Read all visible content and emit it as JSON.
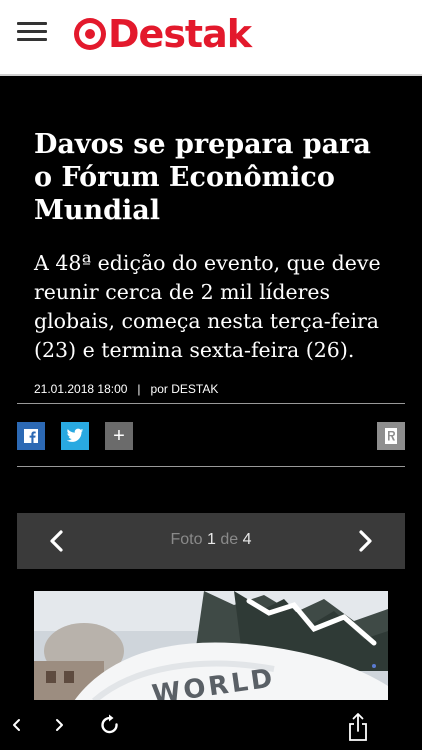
{
  "header": {
    "logo_text": "Destak",
    "brand_color": "#e3192c"
  },
  "article": {
    "title": "Davos se prepara para o Fórum Econômico Mundial",
    "lede": "A 48ª edição do evento, que deve reunir cerca de 2 mil líderes globais, começa nesta terça-feira (23) e termina sexta-feira (26).",
    "date": "21.01.2018 18:00",
    "separator": "|",
    "byline": "por DESTAK"
  },
  "share": {
    "icons": [
      "facebook-icon",
      "twitter-icon",
      "plus-icon",
      "r-icon"
    ],
    "plus_label": "+"
  },
  "gallery": {
    "foto_label": "Foto",
    "current": "1",
    "of_label": "de",
    "total": "4"
  },
  "photo": {
    "sign_text": "WORLD"
  },
  "browser": {
    "icons": [
      "back-icon",
      "forward-icon",
      "reload-icon",
      "share-icon"
    ]
  }
}
